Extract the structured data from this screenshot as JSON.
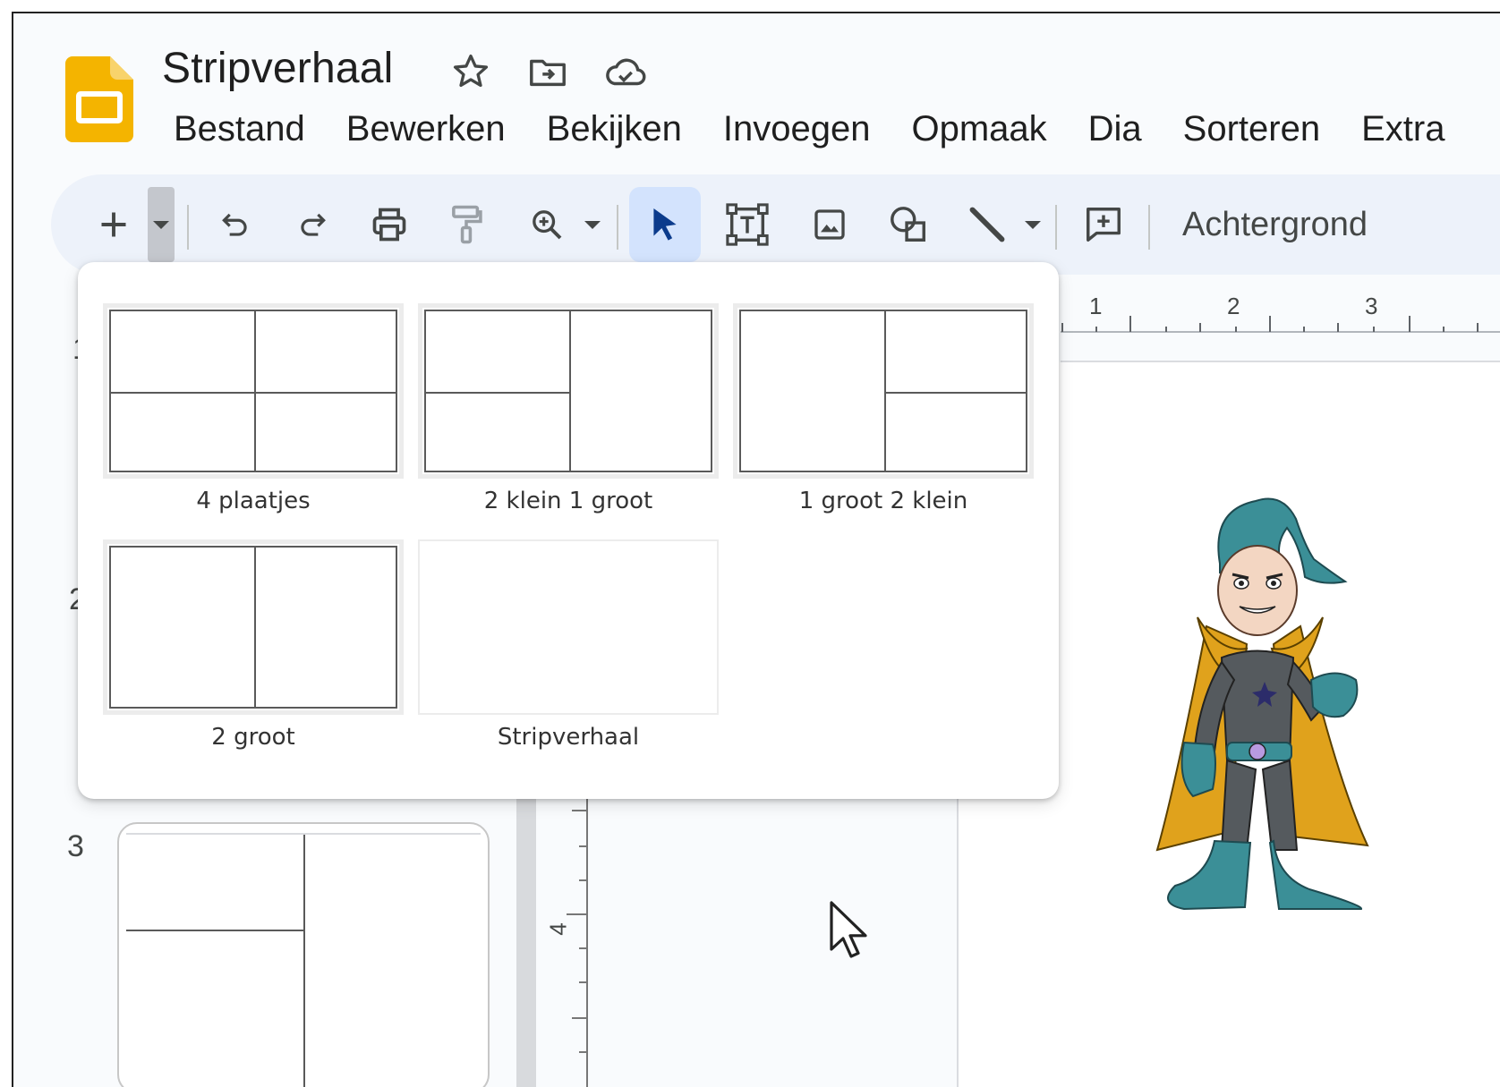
{
  "document": {
    "title": "Stripverhaal",
    "title_icons": [
      "star-icon",
      "move-to-folder-icon",
      "cloud-status-icon"
    ]
  },
  "menu": [
    "Bestand",
    "Bewerken",
    "Bekijken",
    "Invoegen",
    "Opmaak",
    "Dia",
    "Sorteren",
    "Extra"
  ],
  "toolbar": {
    "tools": [
      "new-slide-icon",
      "layout-dropdown-icon",
      "undo-icon",
      "redo-icon",
      "print-icon",
      "paint-format-icon",
      "zoom-icon",
      "select-icon",
      "text-box-icon",
      "image-icon",
      "shape-icon",
      "line-icon",
      "comment-icon"
    ],
    "background_label": "Achtergrond"
  },
  "ruler": {
    "h_numbers": [
      "1",
      "2",
      "3"
    ],
    "v_numbers": [
      "4"
    ]
  },
  "filmstrip": {
    "slide_numbers": [
      "1",
      "2",
      "3"
    ]
  },
  "layouts": [
    {
      "name": "4 plaatjes",
      "preview": "four-grid"
    },
    {
      "name": "2 klein 1 groot",
      "preview": "two-small-left-one-large-right"
    },
    {
      "name": "1 groot 2 klein",
      "preview": "one-large-left-two-small-right"
    },
    {
      "name": "2 groot",
      "preview": "two-columns"
    },
    {
      "name": "Stripverhaal",
      "preview": "blank"
    }
  ],
  "colors": {
    "slides_logo": "#f4b400",
    "toolbar_bg": "#edf2fa",
    "active_tool_bg": "#d3e3fd",
    "hero_cape": "#e0a21c",
    "hero_teal": "#3b8f97"
  }
}
